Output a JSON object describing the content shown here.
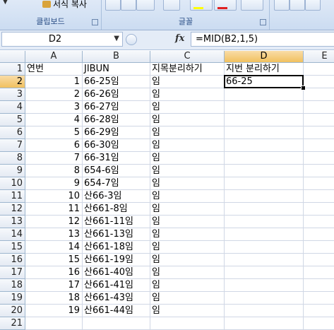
{
  "ribbon": {
    "clipboard_group": {
      "label": "클립보드",
      "format_painter_label": "서식 복사"
    },
    "font_group": {
      "label": "글꼴"
    }
  },
  "formula_bar": {
    "name_box": "D2",
    "fx_label": "fx",
    "formula": "=MID(B2,1,5)"
  },
  "columns": [
    "A",
    "B",
    "C",
    "D",
    "E"
  ],
  "rows": [
    {
      "n": "1",
      "A": "연번",
      "B": "JIBUN",
      "C": "지목분리하기",
      "D": "지번 분리하기"
    },
    {
      "n": "2",
      "A": "1",
      "B": "66-25임",
      "C": "임",
      "D": "66-25"
    },
    {
      "n": "3",
      "A": "2",
      "B": "66-26임",
      "C": "임",
      "D": ""
    },
    {
      "n": "4",
      "A": "3",
      "B": "66-27임",
      "C": "임",
      "D": ""
    },
    {
      "n": "5",
      "A": "4",
      "B": "66-28임",
      "C": "임",
      "D": ""
    },
    {
      "n": "6",
      "A": "5",
      "B": "66-29임",
      "C": "임",
      "D": ""
    },
    {
      "n": "7",
      "A": "6",
      "B": "66-30임",
      "C": "임",
      "D": ""
    },
    {
      "n": "8",
      "A": "7",
      "B": "66-31임",
      "C": "임",
      "D": ""
    },
    {
      "n": "9",
      "A": "8",
      "B": "654-6임",
      "C": "임",
      "D": ""
    },
    {
      "n": "10",
      "A": "9",
      "B": "654-7임",
      "C": "임",
      "D": ""
    },
    {
      "n": "11",
      "A": "10",
      "B": "산66-3임",
      "C": "임",
      "D": ""
    },
    {
      "n": "12",
      "A": "11",
      "B": "산661-8임",
      "C": "임",
      "D": ""
    },
    {
      "n": "13",
      "A": "12",
      "B": "산661-11임",
      "C": "임",
      "D": ""
    },
    {
      "n": "14",
      "A": "13",
      "B": "산661-13임",
      "C": "임",
      "D": ""
    },
    {
      "n": "15",
      "A": "14",
      "B": "산661-18임",
      "C": "임",
      "D": ""
    },
    {
      "n": "16",
      "A": "15",
      "B": "산661-19임",
      "C": "임",
      "D": ""
    },
    {
      "n": "17",
      "A": "16",
      "B": "산661-40임",
      "C": "임",
      "D": ""
    },
    {
      "n": "18",
      "A": "17",
      "B": "산661-41임",
      "C": "임",
      "D": ""
    },
    {
      "n": "19",
      "A": "18",
      "B": "산661-43임",
      "C": "임",
      "D": ""
    },
    {
      "n": "20",
      "A": "19",
      "B": "산661-44임",
      "C": "임",
      "D": ""
    },
    {
      "n": "21",
      "A": "",
      "B": "",
      "C": "",
      "D": ""
    }
  ],
  "selected_cell": "D2",
  "colors": {
    "selected_header": "#f1c15f",
    "grid_line": "#d0d7e5",
    "ribbon_bg": "#dfe9f7"
  }
}
